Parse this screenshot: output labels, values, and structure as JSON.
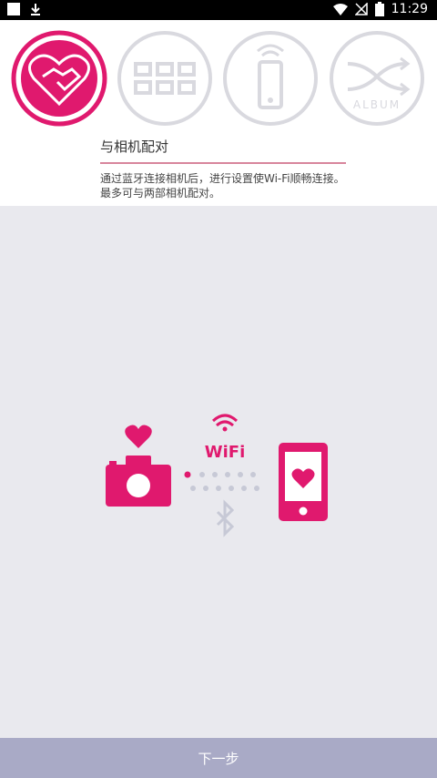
{
  "status_bar": {
    "time": "11:29"
  },
  "steps": [
    {
      "name": "pairing",
      "active": true
    },
    {
      "name": "grid",
      "active": false
    },
    {
      "name": "phone-wifi",
      "active": false
    },
    {
      "name": "album",
      "active": false,
      "label": "ALBUM"
    }
  ],
  "page": {
    "title": "与相机配对",
    "description": "通过蓝牙连接相机后，进行设置使Wi-Fi顺畅连接。最多可与两部相机配对。"
  },
  "illustration": {
    "wifi_label": "WiFi"
  },
  "footer": {
    "next_label": "下一步"
  },
  "colors": {
    "accent": "#e0196e",
    "inactive": "#d9d9df",
    "footer": "#a9aac6",
    "background": "#e9e9ee"
  }
}
